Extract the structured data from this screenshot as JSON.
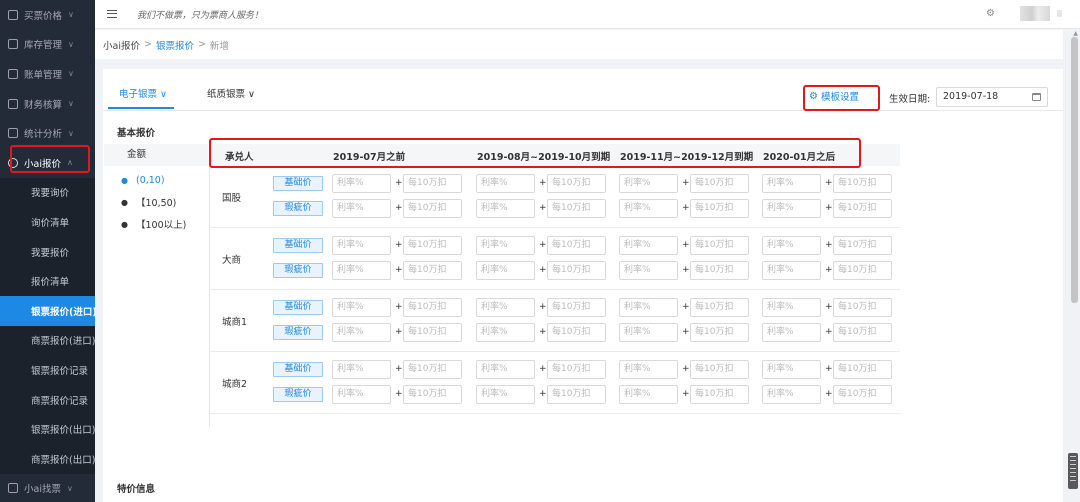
{
  "sidebar": {
    "top_items": [
      {
        "label": "买票价格",
        "icon": "location-icon"
      },
      {
        "label": "库存管理",
        "icon": "box-icon"
      },
      {
        "label": "账单管理",
        "icon": "bill-icon"
      },
      {
        "label": "财务核算",
        "icon": "finance-icon"
      },
      {
        "label": "统计分析",
        "icon": "chart-icon"
      }
    ],
    "open_item": {
      "label": "小ai报价",
      "icon": "target-icon"
    },
    "sub_items": [
      {
        "label": "我要询价"
      },
      {
        "label": "询价清单"
      },
      {
        "label": "我要报价"
      },
      {
        "label": "报价清单"
      },
      {
        "label": "银票报价(进口)",
        "active": true
      },
      {
        "label": "商票报价(进口)"
      },
      {
        "label": "银票报价记录"
      },
      {
        "label": "商票报价记录"
      },
      {
        "label": "银票报价(出口)"
      },
      {
        "label": "商票报价(出口)"
      }
    ],
    "bottom_item": {
      "label": "小ai找票",
      "icon": "search-ticket-icon"
    },
    "highlight_color": "#1e88e5"
  },
  "header": {
    "slogan": "我们不做票，只为票商人服务！"
  },
  "breadcrumb": {
    "root": "小ai报价",
    "sep1": ">",
    "link": "银票报价",
    "sep2": ">",
    "current": "新增"
  },
  "tabs": [
    {
      "label": "电子银票 ∨",
      "active": true
    },
    {
      "label": "纸质银票 ∨",
      "active": false
    }
  ],
  "toolbar": {
    "template_label": "模板设置",
    "effective_label": "生效日期:",
    "effective_date": "2019-07-18"
  },
  "section": {
    "basic_title": "基本报价",
    "special_title": "特价信息"
  },
  "amounts": {
    "header": "金额",
    "items": [
      "(0,10)",
      "【10,50)",
      "【100以上)"
    ]
  },
  "table": {
    "headers": [
      "承兑人",
      "2019-07月之前",
      "2019-08月~2019-10月到期",
      "2019-11月~2019-12月到期",
      "2020-01月之后"
    ],
    "acceptors": [
      "国股",
      "大商",
      "城商1",
      "城商2"
    ],
    "tag_base": "基础价",
    "tag_flaw": "瑕疵价",
    "rate_placeholder": "利率%",
    "deduct_placeholder": "每10万扣",
    "plus": "+"
  },
  "colors": {
    "accent": "#1e88e5",
    "annotation_red": "#e3171c",
    "sidebar_bg": "#232b38"
  }
}
